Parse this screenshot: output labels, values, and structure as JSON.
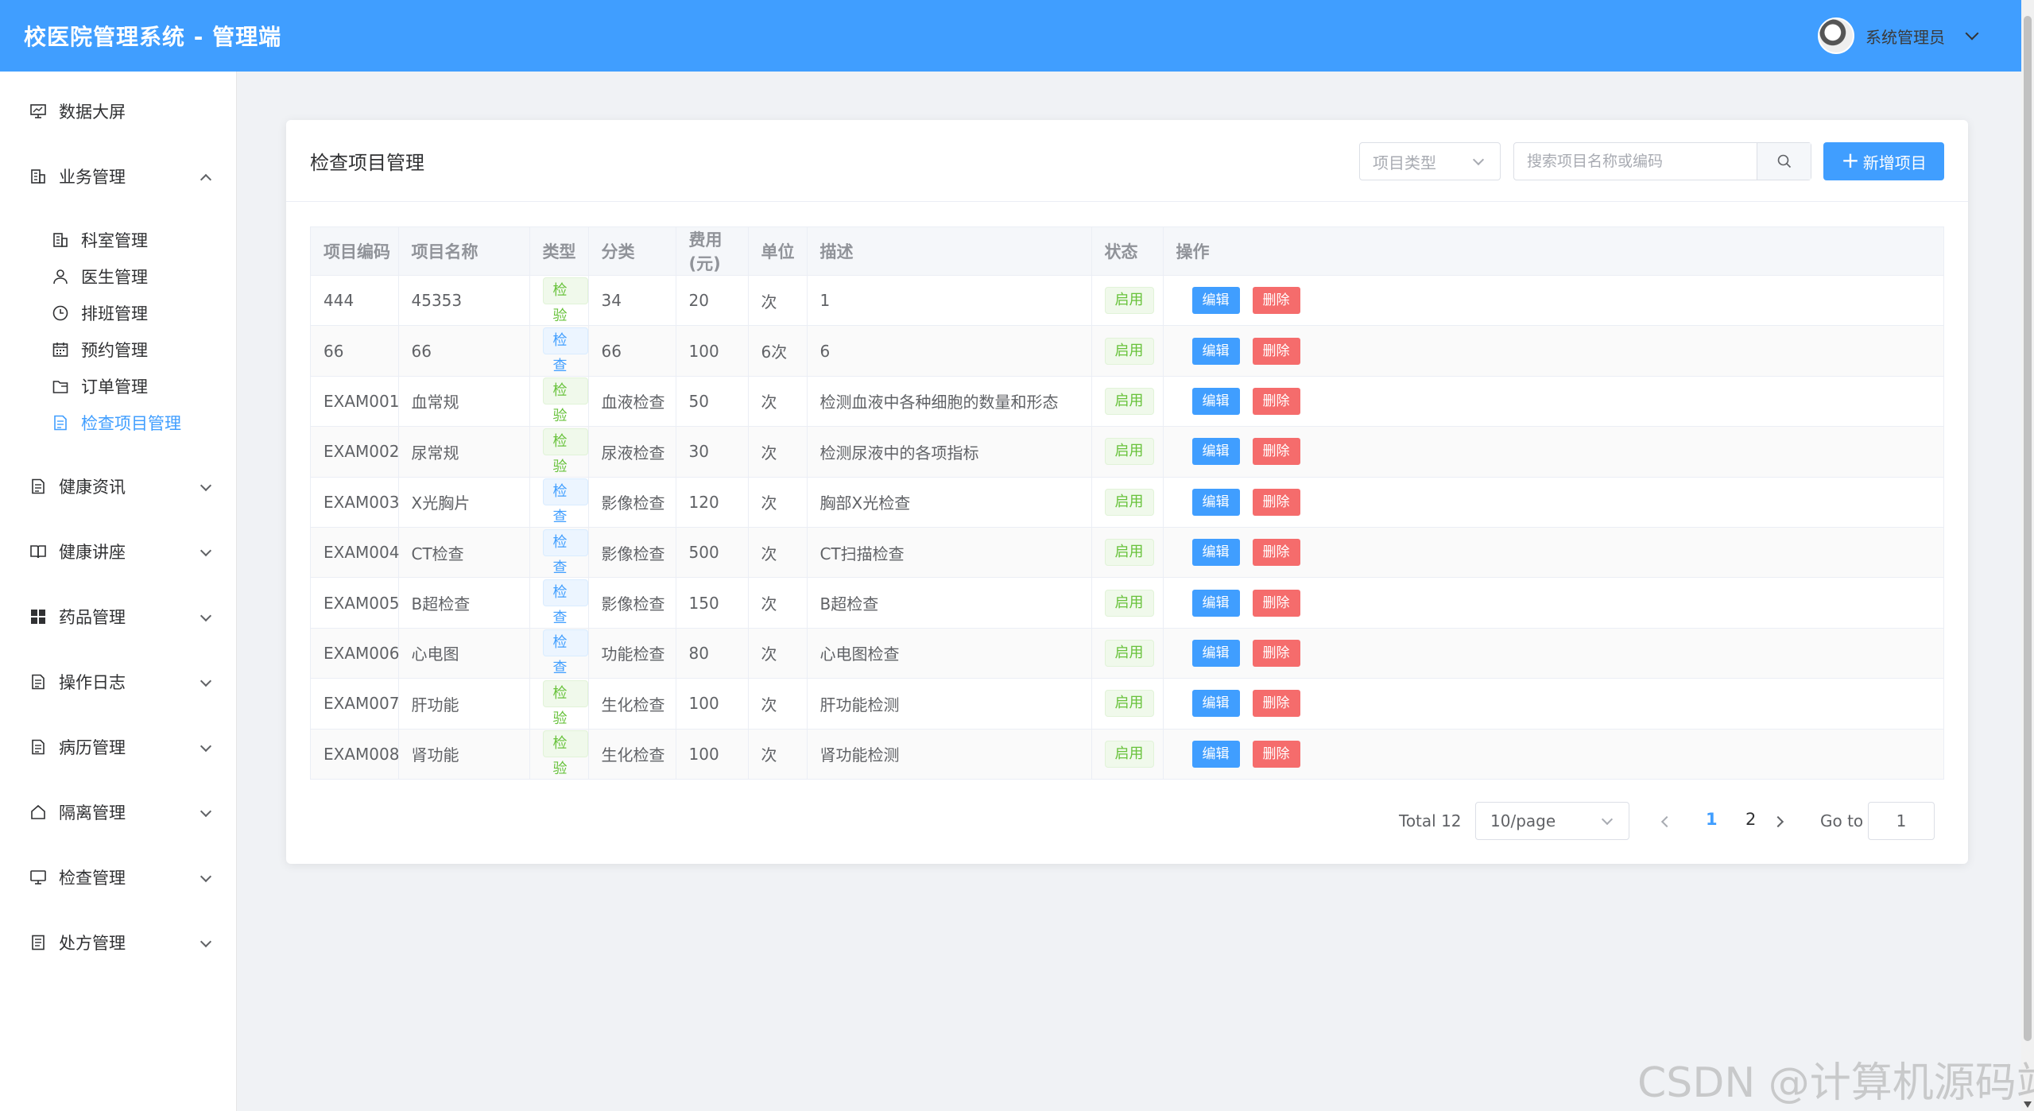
{
  "header": {
    "title": "校医院管理系统 - 管理端",
    "user_name": "系统管理员"
  },
  "sidebar": {
    "items": [
      {
        "label": "数据大屏",
        "icon": "monitor-chart-icon",
        "level": "top",
        "chevron": "none"
      },
      {
        "label": "业务管理",
        "icon": "office-building-icon",
        "level": "top",
        "chevron": "up"
      },
      {
        "label": "科室管理",
        "icon": "office-building-icon",
        "level": "sub",
        "chevron": "none"
      },
      {
        "label": "医生管理",
        "icon": "user-icon",
        "level": "sub",
        "chevron": "none"
      },
      {
        "label": "排班管理",
        "icon": "clock-icon",
        "level": "sub",
        "chevron": "none"
      },
      {
        "label": "预约管理",
        "icon": "calendar-icon",
        "level": "sub",
        "chevron": "none"
      },
      {
        "label": "订单管理",
        "icon": "folder-icon",
        "level": "sub",
        "chevron": "none"
      },
      {
        "label": "检查项目管理",
        "icon": "document-icon",
        "level": "sub",
        "chevron": "none",
        "active": true
      },
      {
        "label": "健康资讯",
        "icon": "document-icon",
        "level": "top",
        "chevron": "down"
      },
      {
        "label": "健康讲座",
        "icon": "book-icon",
        "level": "top",
        "chevron": "down"
      },
      {
        "label": "药品管理",
        "icon": "grid-icon",
        "level": "top",
        "chevron": "down"
      },
      {
        "label": "操作日志",
        "icon": "document-icon",
        "level": "top",
        "chevron": "down"
      },
      {
        "label": "病历管理",
        "icon": "document-icon",
        "level": "top",
        "chevron": "down"
      },
      {
        "label": "隔离管理",
        "icon": "house-icon",
        "level": "top",
        "chevron": "down"
      },
      {
        "label": "检查管理",
        "icon": "monitor-icon",
        "level": "top",
        "chevron": "down"
      },
      {
        "label": "处方管理",
        "icon": "notebook-icon",
        "level": "top",
        "chevron": "down"
      }
    ]
  },
  "card": {
    "title": "检查项目管理",
    "type_select_placeholder": "项目类型",
    "search_placeholder": "搜索项目名称或编码",
    "add_button_label": "新增项目"
  },
  "table": {
    "columns": [
      "项目编码",
      "项目名称",
      "类型",
      "分类",
      "费用(元)",
      "单位",
      "描述",
      "状态",
      "操作"
    ],
    "edit_label": "编辑",
    "delete_label": "删除",
    "rows": [
      {
        "code": "444",
        "name": "45353",
        "type": "检验",
        "category": "34",
        "fee": "20",
        "unit": "次",
        "desc": "1",
        "status": "启用"
      },
      {
        "code": "66",
        "name": "66",
        "type": "检查",
        "category": "66",
        "fee": "100",
        "unit": "6次",
        "desc": "6",
        "status": "启用"
      },
      {
        "code": "EXAM001",
        "name": "血常规",
        "type": "检验",
        "category": "血液检查",
        "fee": "50",
        "unit": "次",
        "desc": "检测血液中各种细胞的数量和形态",
        "status": "启用"
      },
      {
        "code": "EXAM002",
        "name": "尿常规",
        "type": "检验",
        "category": "尿液检查",
        "fee": "30",
        "unit": "次",
        "desc": "检测尿液中的各项指标",
        "status": "启用"
      },
      {
        "code": "EXAM003",
        "name": "X光胸片",
        "type": "检查",
        "category": "影像检查",
        "fee": "120",
        "unit": "次",
        "desc": "胸部X光检查",
        "status": "启用"
      },
      {
        "code": "EXAM004",
        "name": "CT检查",
        "type": "检查",
        "category": "影像检查",
        "fee": "500",
        "unit": "次",
        "desc": "CT扫描检查",
        "status": "启用"
      },
      {
        "code": "EXAM005",
        "name": "B超检查",
        "type": "检查",
        "category": "影像检查",
        "fee": "150",
        "unit": "次",
        "desc": "B超检查",
        "status": "启用"
      },
      {
        "code": "EXAM006",
        "name": "心电图",
        "type": "检查",
        "category": "功能检查",
        "fee": "80",
        "unit": "次",
        "desc": "心电图检查",
        "status": "启用"
      },
      {
        "code": "EXAM007",
        "name": "肝功能",
        "type": "检验",
        "category": "生化检查",
        "fee": "100",
        "unit": "次",
        "desc": "肝功能检测",
        "status": "启用"
      },
      {
        "code": "EXAM008",
        "name": "肾功能",
        "type": "检验",
        "category": "生化检查",
        "fee": "100",
        "unit": "次",
        "desc": "肾功能检测",
        "status": "启用"
      }
    ]
  },
  "pagination": {
    "total_text": "Total 12",
    "page_size": "10/page",
    "pages": [
      "1",
      "2"
    ],
    "current_page": "1",
    "goto_label": "Go to",
    "goto_value": "1"
  },
  "watermark": "CSDN @计算机源码站",
  "colors": {
    "primary": "#409eff",
    "success": "#67c23a",
    "danger": "#f56c6c"
  }
}
